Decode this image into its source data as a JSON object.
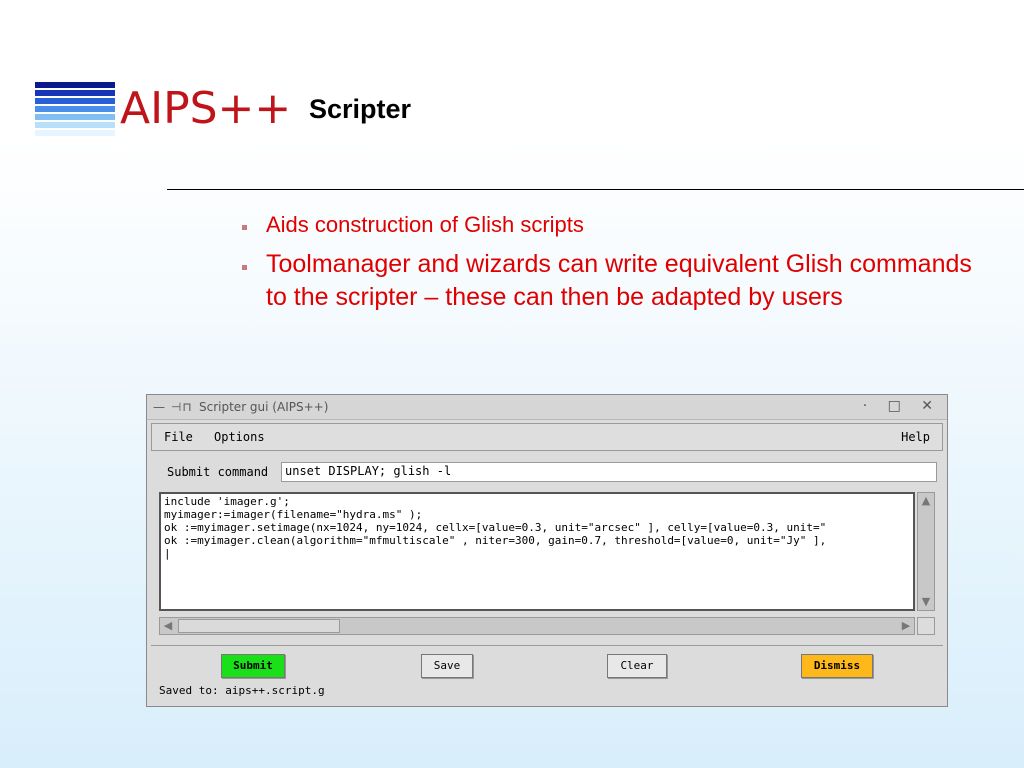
{
  "slide": {
    "logo_text": "AIPS++",
    "title": "Scripter",
    "bullets": [
      "Aids construction of Glish scripts",
      "Toolmanager and wizards can write equivalent Glish commands to the scripter – these can then be adapted by users"
    ],
    "colors": {
      "bullet_text": "#e00000",
      "logo_red": "#c0141b"
    }
  },
  "window": {
    "title": "Scripter gui (AIPS++)",
    "title_left_glyphs": "— ⊣⊓",
    "title_right_glyphs": "· □ ✕",
    "menu": {
      "file": "File",
      "options": "Options",
      "help": "Help"
    },
    "command": {
      "label": "Submit command",
      "value": "unset DISPLAY; glish -l"
    },
    "editor_text": "include 'imager.g';\nmyimager:=imager(filename=\"hydra.ms\" );\nok :=myimager.setimage(nx=1024, ny=1024, cellx=[value=0.3, unit=\"arcsec\" ], celly=[value=0.3, unit=\"\nok :=myimager.clean(algorithm=\"mfmultiscale\" , niter=300, gain=0.7, threshold=[value=0, unit=\"Jy\" ],\n|",
    "buttons": {
      "submit": "Submit",
      "save": "Save",
      "clear": "Clear",
      "dismiss": "Dismiss"
    },
    "status": "Saved to: aips++.script.g",
    "colors": {
      "submit": "#19e019",
      "dismiss": "#ffb81a"
    }
  }
}
